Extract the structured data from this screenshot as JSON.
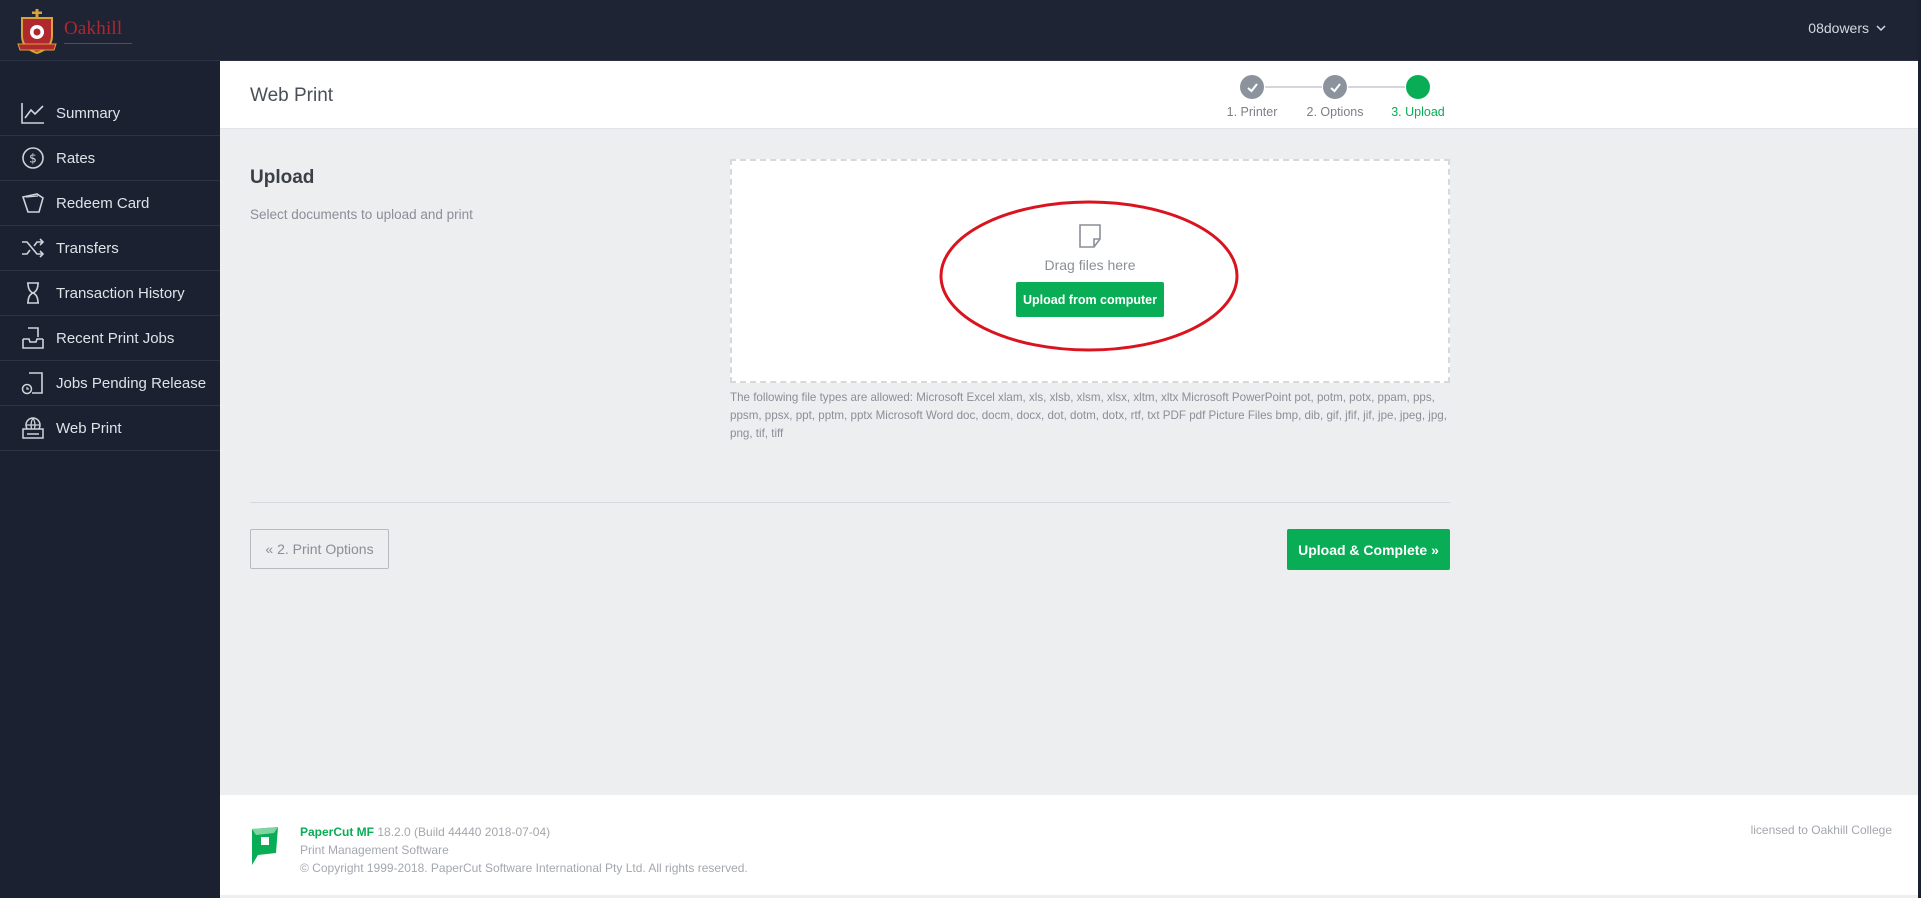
{
  "app": {
    "logo_text": "Oakhill",
    "user": "08dowers"
  },
  "sidebar": {
    "items": [
      {
        "label": "Summary",
        "icon": "line-chart-icon"
      },
      {
        "label": "Rates",
        "icon": "dollar-circle-icon"
      },
      {
        "label": "Redeem Card",
        "icon": "card-icon"
      },
      {
        "label": "Transfers",
        "icon": "shuffle-icon"
      },
      {
        "label": "Transaction History",
        "icon": "hourglass-icon"
      },
      {
        "label": "Recent Print Jobs",
        "icon": "inbox-tray-icon"
      },
      {
        "label": "Jobs Pending Release",
        "icon": "pending-doc-icon"
      },
      {
        "label": "Web Print",
        "icon": "globe-printer-icon"
      }
    ]
  },
  "header": {
    "title": "Web Print",
    "steps": [
      {
        "label": "1. Printer",
        "state": "done"
      },
      {
        "label": "2. Options",
        "state": "done"
      },
      {
        "label": "3. Upload",
        "state": "current"
      }
    ]
  },
  "upload": {
    "title": "Upload",
    "subtitle": "Select documents to upload and print",
    "drag_text": "Drag files here",
    "upload_button": "Upload from computer",
    "file_types": "The following file types are allowed: Microsoft Excel xlam, xls, xlsb, xlsm, xlsx, xltm, xltx Microsoft PowerPoint pot, potm, potx, ppam, pps, ppsm, ppsx, ppt, pptm, pptx Microsoft Word doc, docm, docx, dot, dotm, dotx, rtf, txt PDF pdf Picture Files bmp, dib, gif, jfif, jif, jpe, jpeg, jpg, png, tif, tiff"
  },
  "actions": {
    "back_label": "« 2. Print Options",
    "complete_label": "Upload & Complete »"
  },
  "footer": {
    "brand": "PaperCut MF",
    "version": "18.2.0 (Build 44440 2018-07-04)",
    "tagline": "Print Management Software",
    "copyright": "© Copyright 1999-2018. PaperCut Software International Pty Ltd. All rights reserved.",
    "licensed": "licensed to Oakhill College"
  },
  "colors": {
    "accent": "#09ad55",
    "sidebar_bg": "#1b2130",
    "annotation": "#d9141f"
  }
}
